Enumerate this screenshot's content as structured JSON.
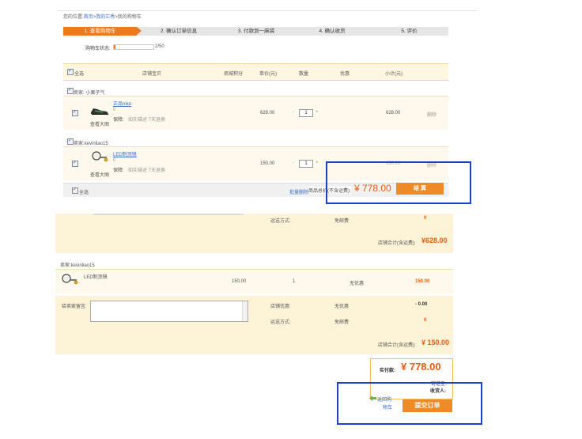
{
  "breadcrumb": {
    "prefix": "您的位置:",
    "home": "首页",
    "sep1": ">",
    "mine": "我的汇秀",
    "sep2": ">",
    "current": "我的购物车"
  },
  "steps": [
    {
      "label": "1. 查看购物车",
      "active": true
    },
    {
      "label": "2. 确认订单信息",
      "active": false
    },
    {
      "label": "3. 付款到一麻袋",
      "active": false
    },
    {
      "label": "4. 确认收货",
      "active": false
    },
    {
      "label": "5. 评价",
      "active": false
    }
  ],
  "cart_status": {
    "label": "购物车状态:",
    "count": "2/50"
  },
  "table_header": {
    "select_all": "全选",
    "item": "店铺宝贝",
    "points": "商城积分",
    "price": "单价(元)",
    "qty": "数量",
    "discount": "优惠",
    "subtotal": "小计(元)"
  },
  "cart_sellers": [
    {
      "label": "卖家:",
      "name": "小栗子气"
    },
    {
      "label": "卖家:",
      "name": "kevinliao15"
    }
  ],
  "cart_items": [
    {
      "title": "正品nike",
      "zero": "0",
      "guarantee": "保障:",
      "guarantee_text": "如实描述 7天退换",
      "view": "查看大图",
      "price": "628.00",
      "qty": "1",
      "minus": "-",
      "plus": "+",
      "subtotal": "628.00",
      "delete": "删除"
    },
    {
      "title": "LED制顶镜",
      "zero": "0",
      "guarantee": "保障:",
      "guarantee_text": "如实描述 7天退换",
      "view": "查看大图",
      "price": "150.00",
      "qty": "1",
      "minus": "-",
      "plus": "+",
      "subtotal": "150.00",
      "delete": "删除"
    }
  ],
  "cart_footer": {
    "select_all": "全选",
    "batch_delete": "批量删除",
    "total_label": "商品总价(不含运费):",
    "total": "¥ 778.00",
    "checkout": "结 算"
  },
  "order": {
    "section1": {
      "shipping_label": "运送方式:",
      "shipping_value": "免邮费",
      "shipping_cost": "0",
      "store_total_label": "店铺合计(含运费):",
      "store_total": "¥628.00"
    },
    "seller2": {
      "label": "卖家:",
      "name": "kevinliao15"
    },
    "item2": {
      "name": "LED制顶镜",
      "price": "150.00",
      "qty": "1",
      "discount": "无优惠",
      "subtotal": "150.00"
    },
    "section2": {
      "message_label": "给卖家留言:",
      "store_discount_label": "店铺优惠:",
      "store_discount_value": "无优惠",
      "store_discount_amount": "- 0.00",
      "shipping_label": "运送方式:",
      "shipping_value": "免邮费",
      "shipping_cost": "0",
      "store_total_label": "店铺合计(含运费):",
      "store_total": "¥ 150.00"
    },
    "summary": {
      "paid_label": "实付款:",
      "paid": "¥ 778.00",
      "address_label": "寄送至:",
      "receiver_label": "收货人:"
    },
    "back_link_1": "返回购",
    "back_link_2": "物车",
    "submit": "提交订单"
  },
  "colors": {
    "accent": "#ee7a1e",
    "price_red": "#ef5b0c",
    "highlight_box": "#1e3ecc"
  }
}
